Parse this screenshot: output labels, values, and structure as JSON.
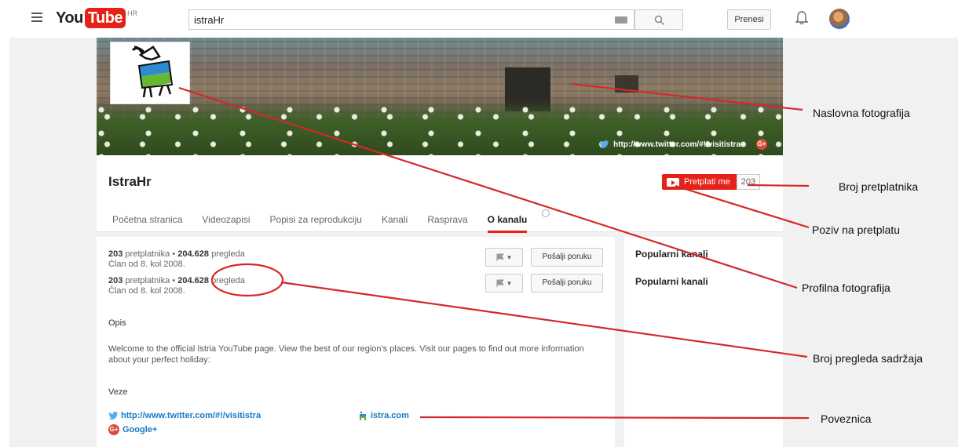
{
  "topbar": {
    "logo_you": "You",
    "logo_tube": "Tube",
    "logo_country": "HR",
    "search_value": "istraHr",
    "upload_label": "Prenesi"
  },
  "banner": {
    "link_text": "http://www.twitter.com/#!/visitistra",
    "gplus": "G+"
  },
  "channel": {
    "name": "IstraHr",
    "subscribe_label": "Pretplati me",
    "subscriber_count": "203",
    "tabs": [
      "Početna stranica",
      "Videozapisi",
      "Popisi za reprodukciju",
      "Kanali",
      "Rasprava",
      "O kanalu"
    ]
  },
  "about": {
    "stats_1": {
      "subs": "203",
      "subs_text": "pretplatnika •",
      "views": "204.628",
      "views_text": "pregleda",
      "member": "Član od 8. kol 2008."
    },
    "stats_2": {
      "subs": "203",
      "subs_text": "pretplatnika •",
      "views": "204.628",
      "views_text": "pregleda",
      "member": "Član od 8. kol 2008."
    },
    "message_label": "Pošalji poruku",
    "description_heading": "Opis",
    "description": "Welcome to the official Istria YouTube page. View the best of our region's places. Visit our pages to find out more information about your perfect holiday:",
    "links_heading": "Veze",
    "link_twitter": "http://www.twitter.com/#!/visitistra",
    "link_istra": "istra.com",
    "link_google": "Google+"
  },
  "sidebar": {
    "heading_1": "Popularni kanali",
    "heading_2": "Popularni kanali"
  },
  "annotations": {
    "cover": "Naslovna fotografija",
    "subscriber_count": "Broj pretplatnika",
    "subscribe_call": "Poziv na pretplatu",
    "profile": "Profilna fotografija",
    "views": "Broj pregleda sadržaja",
    "link": "Poveznica"
  },
  "colors": {
    "brand_red": "#e62117",
    "link_blue": "#167ac6",
    "annotation_red": "#d4282a"
  }
}
